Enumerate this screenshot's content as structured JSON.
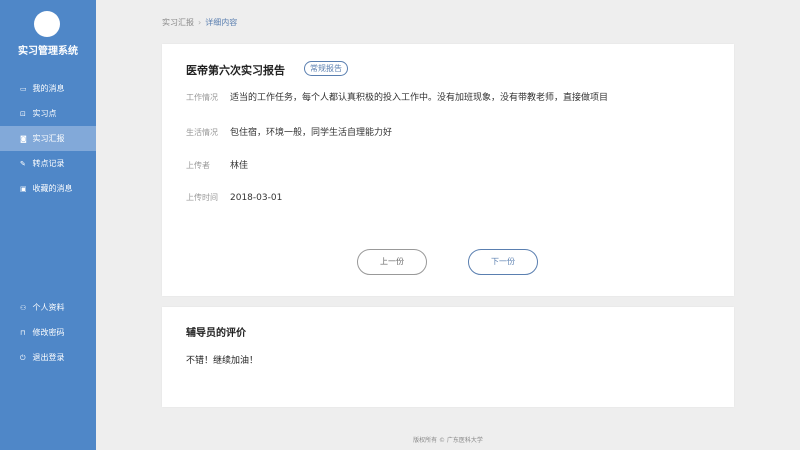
{
  "sidebar": {
    "app_title": "实习管理系统",
    "items": [
      {
        "icon": "message-icon",
        "glyph": "▭",
        "label": "我的消息"
      },
      {
        "icon": "location-icon",
        "glyph": "⊡",
        "label": "实习点"
      },
      {
        "icon": "report-icon",
        "glyph": "◙",
        "label": "实习汇报"
      },
      {
        "icon": "transfer-icon",
        "glyph": "✎",
        "label": "转点记录"
      },
      {
        "icon": "favorite-icon",
        "glyph": "▣",
        "label": "收藏的消息"
      }
    ],
    "bottom_items": [
      {
        "icon": "user-icon",
        "glyph": "⚇",
        "label": "个人资料"
      },
      {
        "icon": "lock-icon",
        "glyph": "⊓",
        "label": "修改密码"
      },
      {
        "icon": "power-icon",
        "glyph": "⏻",
        "label": "退出登录"
      }
    ]
  },
  "breadcrumb": {
    "parent": "实习汇报",
    "separator": "›",
    "current": "详细内容"
  },
  "report": {
    "title": "医帝第六次实习报告",
    "tag": "常规报告",
    "fields": [
      {
        "label": "工作情况",
        "value": "适当的工作任务，每个人都认真积极的投入工作中。没有加班现象，没有带教老师，直接做项目"
      },
      {
        "label": "生活情况",
        "value": "包住宿，环境一般，同学生活自理能力好"
      },
      {
        "label": "上传者",
        "value": "林佳"
      },
      {
        "label": "上传时间",
        "value": "2018-03-01"
      }
    ],
    "prev_label": "上一份",
    "next_label": "下一份"
  },
  "comment": {
    "heading": "辅导员的评价",
    "text": "不错！继续加油！"
  },
  "footer": "版权所有 © 广东医科大学"
}
